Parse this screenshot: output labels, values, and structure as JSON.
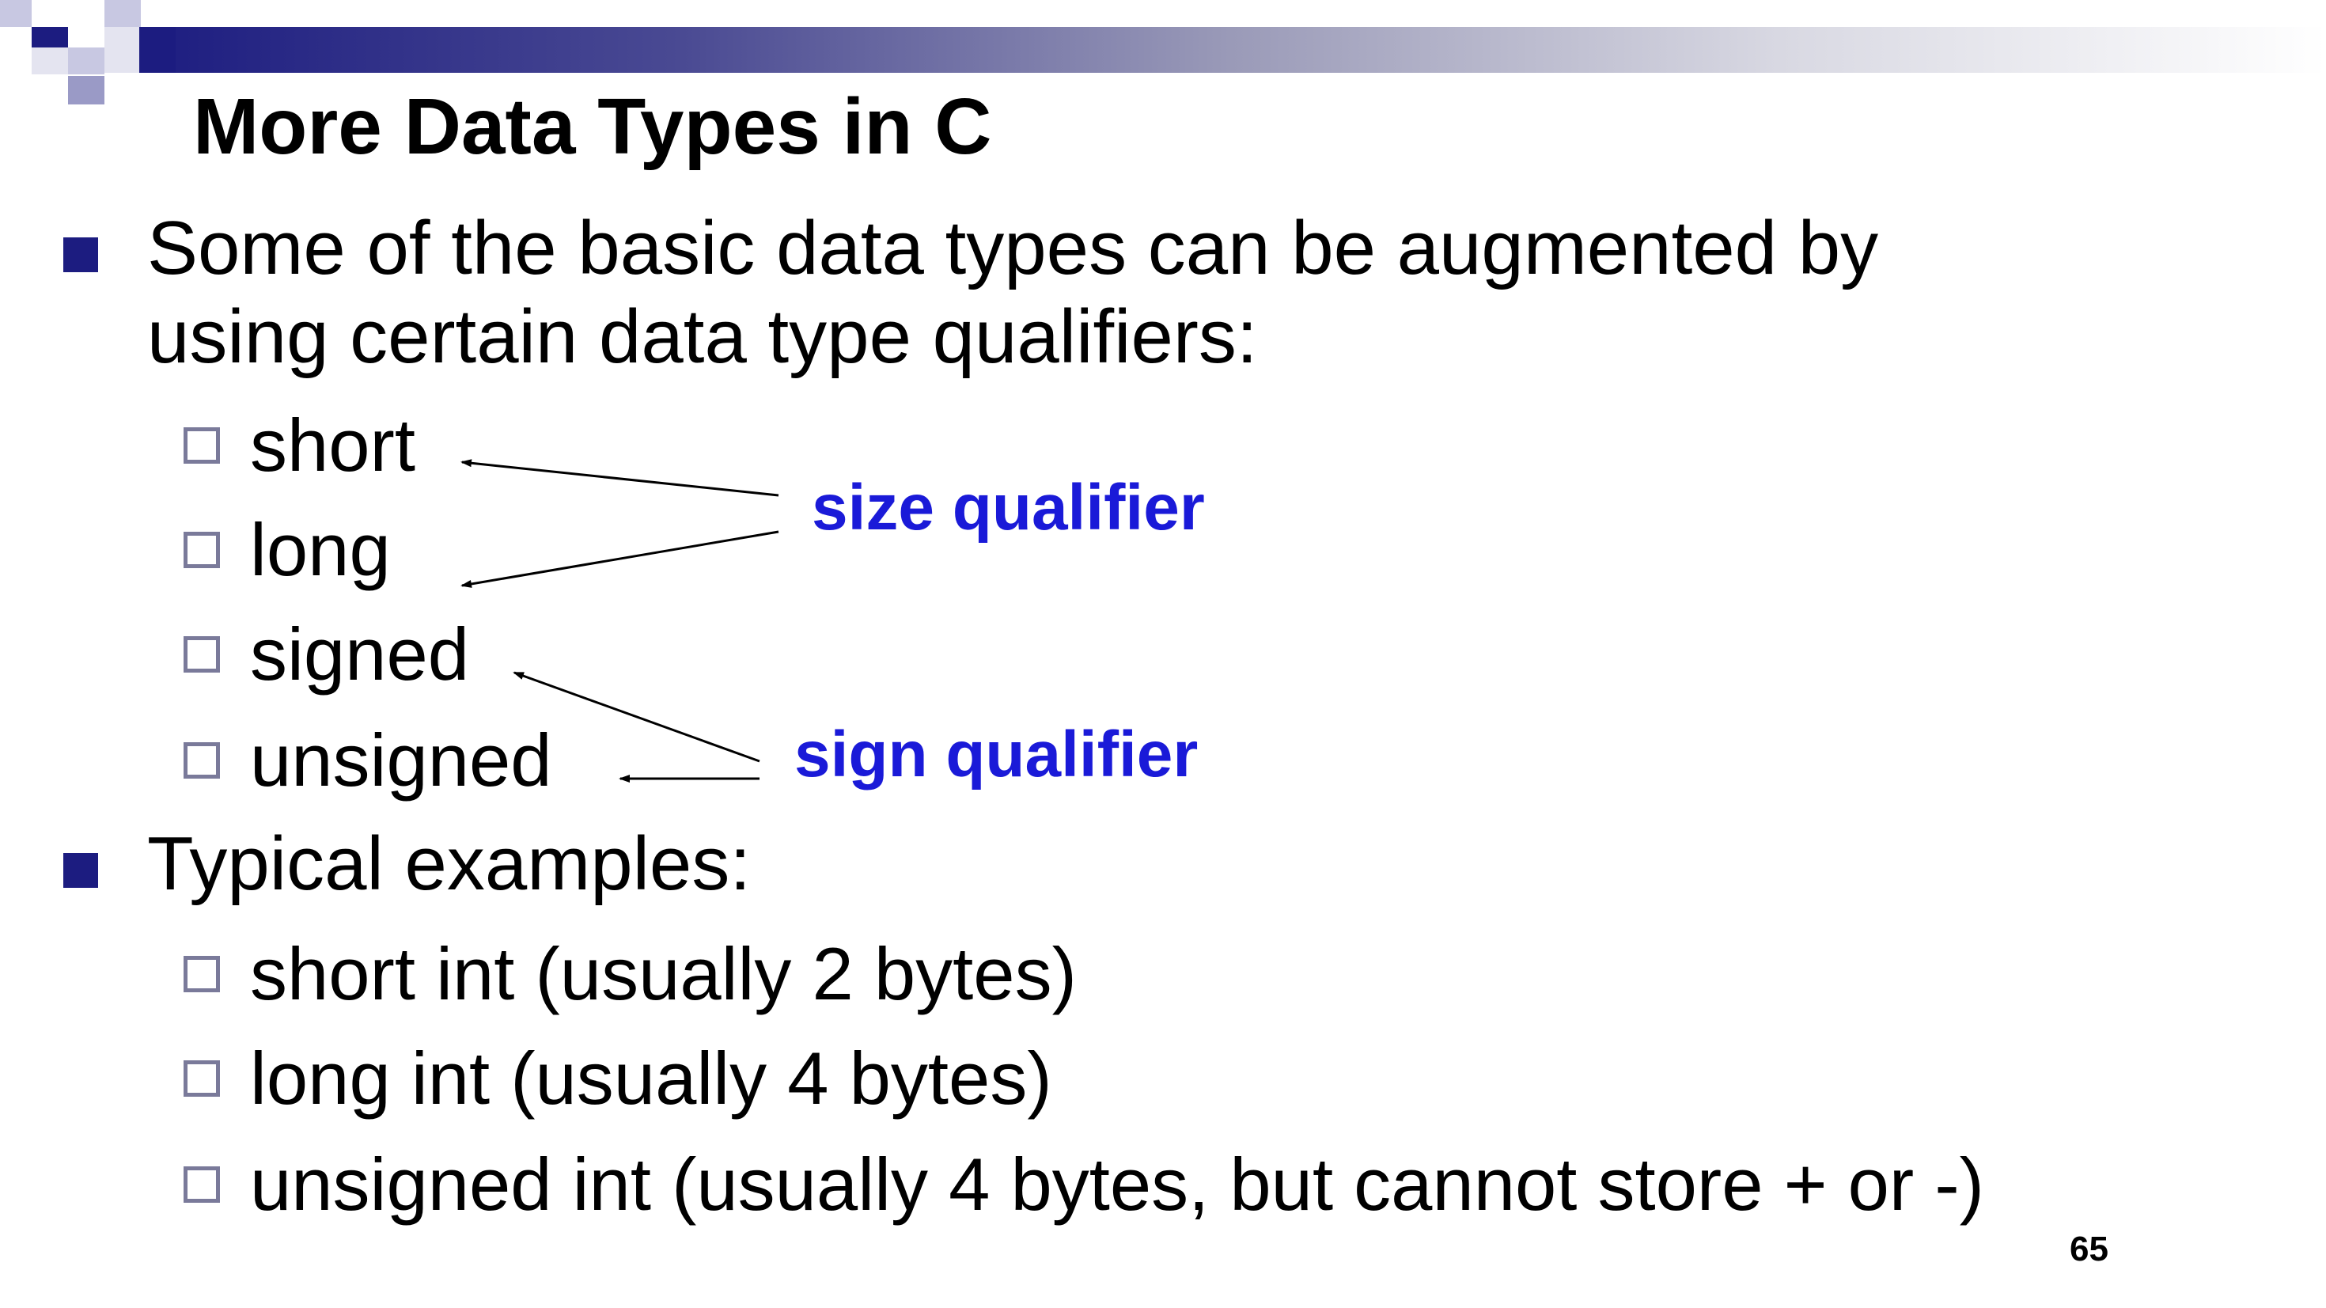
{
  "slide": {
    "title": "More Data Types in C",
    "bullets": [
      {
        "line1": "Some of the basic data types can be augmented by",
        "line2": "using certain data type qualifiers:"
      },
      {
        "line1": "Typical examples:"
      }
    ],
    "qualifiers": [
      "short",
      "long",
      "signed",
      "unsigned"
    ],
    "examples": [
      "short int (usually 2 bytes)",
      "long int (usually 4 bytes)",
      "unsigned int (usually 4 bytes, but cannot store + or -)"
    ],
    "annotations": {
      "size": "size qualifier",
      "sign": "sign qualifier"
    },
    "page_number": "65"
  },
  "colors": {
    "accent": "#1c1c80",
    "annotation": "#1a1ad8",
    "checkbox_border": "#7a7a9a"
  }
}
